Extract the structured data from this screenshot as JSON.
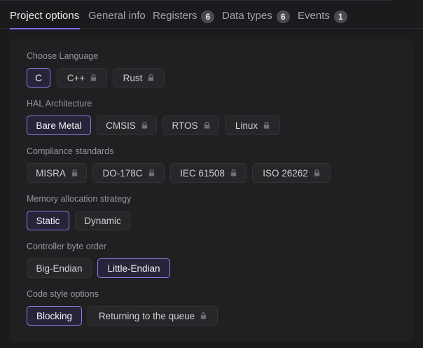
{
  "tabs": [
    {
      "label": "Project options",
      "badge": null
    },
    {
      "label": "General info",
      "badge": null
    },
    {
      "label": "Registers",
      "badge": "6"
    },
    {
      "label": "Data types",
      "badge": "6"
    },
    {
      "label": "Events",
      "badge": "1"
    }
  ],
  "sections": {
    "language": {
      "label": "Choose Language",
      "options": [
        {
          "label": "C",
          "selected": true,
          "locked": false
        },
        {
          "label": "C++",
          "selected": false,
          "locked": true
        },
        {
          "label": "Rust",
          "selected": false,
          "locked": true
        }
      ]
    },
    "hal": {
      "label": "HAL Architecture",
      "options": [
        {
          "label": "Bare Metal",
          "selected": true,
          "locked": false
        },
        {
          "label": "CMSIS",
          "selected": false,
          "locked": true
        },
        {
          "label": "RTOS",
          "selected": false,
          "locked": true
        },
        {
          "label": "Linux",
          "selected": false,
          "locked": true
        }
      ]
    },
    "compliance": {
      "label": "Compliance standards",
      "options": [
        {
          "label": "MISRA",
          "selected": false,
          "locked": true
        },
        {
          "label": "DO-178C",
          "selected": false,
          "locked": true
        },
        {
          "label": "IEC 61508",
          "selected": false,
          "locked": true
        },
        {
          "label": "ISO 26262",
          "selected": false,
          "locked": true
        }
      ]
    },
    "memory": {
      "label": "Memory allocation strategy",
      "options": [
        {
          "label": "Static",
          "selected": true,
          "locked": false
        },
        {
          "label": "Dynamic",
          "selected": false,
          "locked": false
        }
      ]
    },
    "byteorder": {
      "label": "Controller byte order",
      "options": [
        {
          "label": "Big-Endian",
          "selected": false,
          "locked": false
        },
        {
          "label": "Little-Endian",
          "selected": true,
          "locked": false
        }
      ]
    },
    "codestyle": {
      "label": "Code style options",
      "options": [
        {
          "label": "Blocking",
          "selected": true,
          "locked": false
        },
        {
          "label": "Returning to the queue",
          "selected": false,
          "locked": true
        }
      ]
    }
  },
  "colors": {
    "accent": "#7c6fe0",
    "background": "#1b1b1d",
    "panel": "#202022"
  }
}
